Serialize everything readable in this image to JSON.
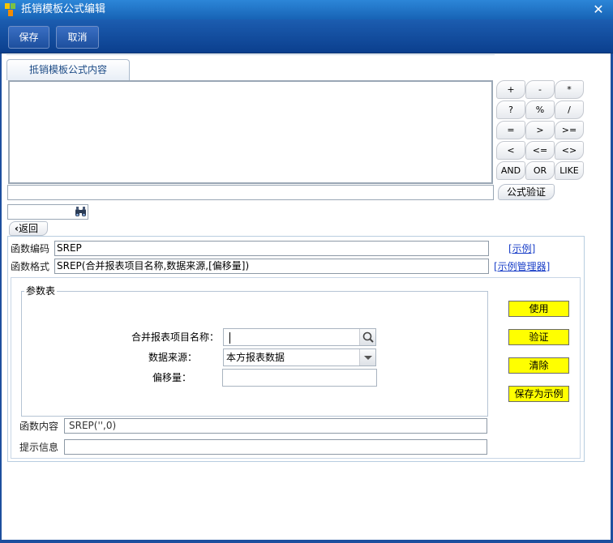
{
  "window": {
    "title": "抵销模板公式编辑",
    "close_icon": "close-icon"
  },
  "toolbar": {
    "save_label": "保存",
    "cancel_label": "取消"
  },
  "tabs": [
    {
      "label": "抵销模板公式内容"
    }
  ],
  "formula": {
    "content": "",
    "operand": ""
  },
  "operators": [
    [
      "+",
      "-",
      "*"
    ],
    [
      "?",
      "%",
      "/"
    ],
    [
      "=",
      ">",
      ">="
    ],
    [
      "<",
      "<=",
      "<>"
    ],
    [
      "AND",
      "OR",
      "LIKE"
    ]
  ],
  "verify_button": "公式验证",
  "search": {
    "value": "",
    "icon": "binoculars-icon"
  },
  "back_button": "返回",
  "function": {
    "code_label": "函数编码",
    "code_value": "SREP",
    "code_link": "[示例]",
    "format_label": "函数格式",
    "format_value": "SREP(合并报表项目名称,数据来源,[偏移量])",
    "format_link": "[示例管理器]"
  },
  "params": {
    "legend": "参数表",
    "item_name_label": "合并报表项目名称：",
    "item_name_value": "",
    "source_label": "数据来源：",
    "source_value": "本方报表数据",
    "offset_label": "偏移量：",
    "offset_value": ""
  },
  "actions": {
    "use": "使用",
    "verify": "验证",
    "clear": "清除",
    "save_example": "保存为示例"
  },
  "content": {
    "label": "函数内容",
    "value": "SREP('',0)"
  },
  "hint": {
    "label": "提示信息",
    "value": ""
  },
  "colors": {
    "titlebar": "#1f6fc4",
    "toolbar": "#164f9f",
    "action_button": "#ffff00",
    "link": "#1a3fc8"
  }
}
